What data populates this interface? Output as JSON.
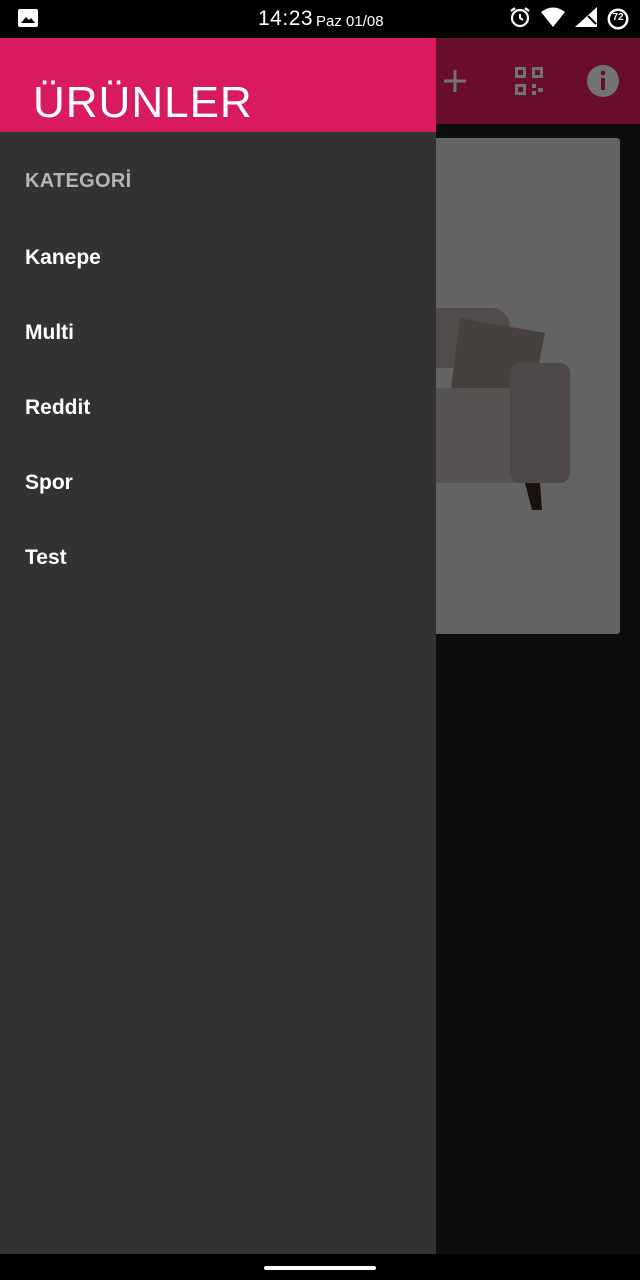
{
  "status_bar": {
    "time": "14:23",
    "date": "Paz 01/08",
    "battery_level": "72",
    "icons": [
      "image-icon",
      "alarm-icon",
      "wifi-icon",
      "signal-icon",
      "battery-icon"
    ]
  },
  "toolbar": {
    "actions": [
      "add-icon",
      "qr-code-icon",
      "info-icon"
    ],
    "color": "#e91e63"
  },
  "drawer": {
    "title": "ÜRÜNLER",
    "header_color": "#d81b60",
    "background_color": "#323232",
    "section_header": "KATEGORİ",
    "items": [
      {
        "label": "Kanepe"
      },
      {
        "label": "Multi"
      },
      {
        "label": "Reddit"
      },
      {
        "label": "Spor"
      },
      {
        "label": "Test"
      }
    ]
  }
}
